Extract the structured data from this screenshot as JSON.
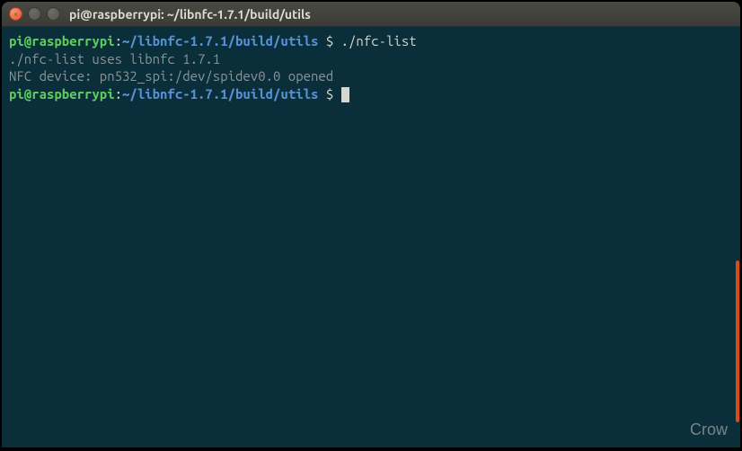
{
  "titlebar": {
    "title": "pi@raspberrypi: ~/libnfc-1.7.1/build/utils"
  },
  "terminal": {
    "lines": [
      {
        "type": "prompt",
        "user": "pi@raspberrypi",
        "sep": ":",
        "path": "~/libnfc-1.7.1/build/utils",
        "dollar": " $ ",
        "command": "./nfc-list"
      },
      {
        "type": "output",
        "text": "./nfc-list uses libnfc 1.7.1"
      },
      {
        "type": "output",
        "text": "NFC device: pn532_spi:/dev/spidev0.0 opened"
      },
      {
        "type": "prompt",
        "user": "pi@raspberrypi",
        "sep": ":",
        "path": "~/libnfc-1.7.1/build/utils",
        "dollar": " $ ",
        "command": "",
        "cursor": true
      }
    ]
  },
  "watermark": "Crow"
}
